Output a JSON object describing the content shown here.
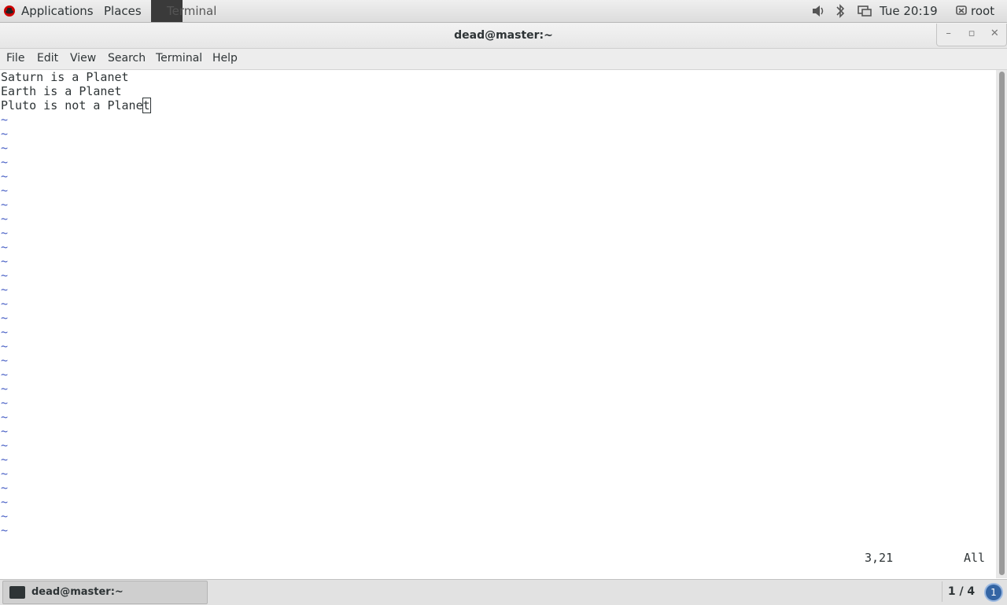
{
  "top_panel": {
    "applications_label": "Applications",
    "places_label": "Places",
    "task_label": "Terminal",
    "clock": "Tue 20:19",
    "user": "root"
  },
  "window": {
    "title": "dead@master:~",
    "minimize_glyph": "–",
    "maximize_glyph": "▫",
    "close_glyph": "✕"
  },
  "menubar": {
    "file": "File",
    "edit": "Edit",
    "view": "View",
    "search": "Search",
    "terminal": "Terminal",
    "help": "Help"
  },
  "editor": {
    "lines": [
      "Saturn is a Planet",
      "Earth is a Planet",
      "Pluto is not a Plane"
    ],
    "cursor_char": "t",
    "tilde": "~",
    "status_position": "3,21",
    "status_scroll": "All"
  },
  "bottom_panel": {
    "task_label": "dead@master:~",
    "workspace": "1 / 4",
    "notification_count": "1"
  },
  "colors": {
    "tilde": "#4b62c6",
    "notification": "#3465a4",
    "text": "#2e3436"
  },
  "icons": {
    "apps": "fedora-logo-icon",
    "volume": "volume-icon",
    "bluetooth": "bluetooth-icon",
    "network": "network-icon",
    "user": "user-icon",
    "terminal": "terminal-icon"
  }
}
